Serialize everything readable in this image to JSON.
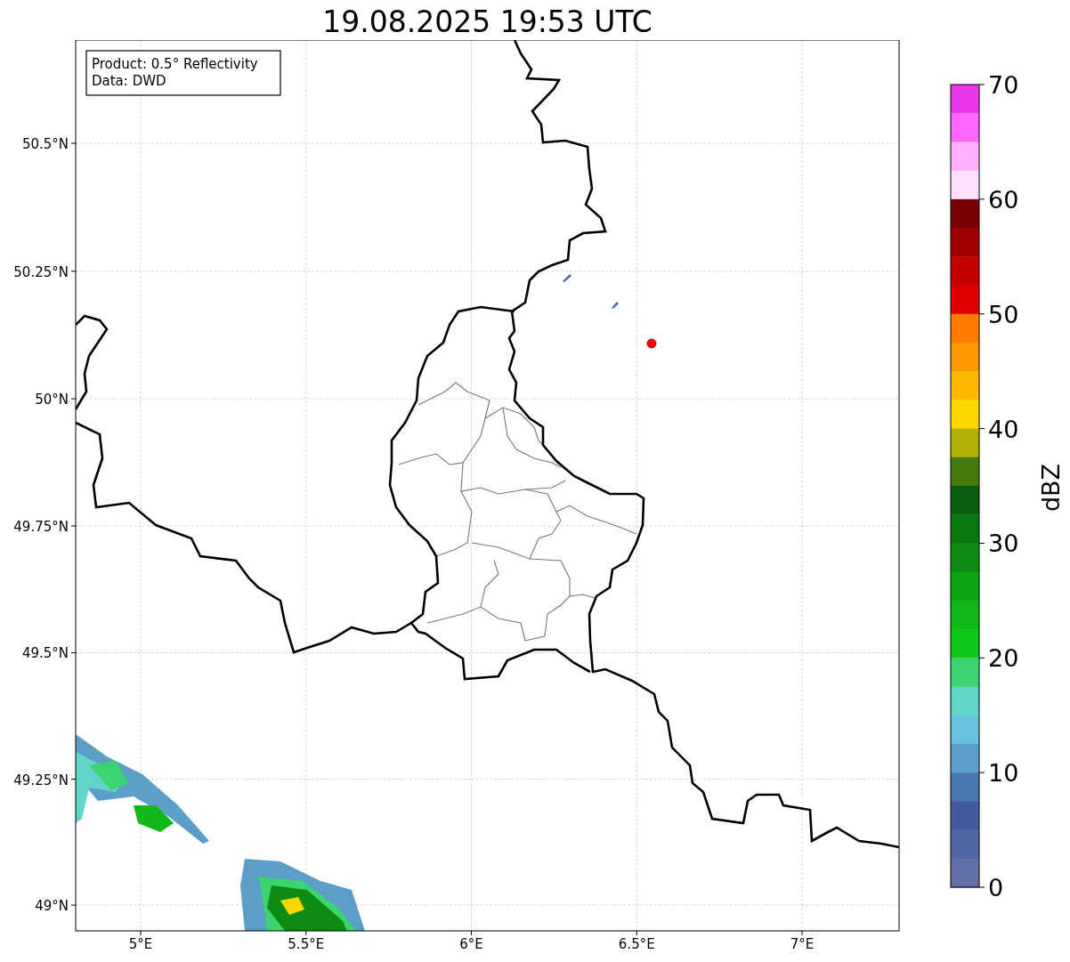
{
  "title": "19.08.2025 19:53 UTC",
  "legend": [
    "Product: 0.5° Reflectivity",
    "Data: DWD"
  ],
  "map": {
    "lat_labels": [
      "50.5°N",
      "50.25°N",
      "50°N",
      "49.75°N",
      "49.5°N",
      "49.25°N",
      "49°N"
    ],
    "lon_labels": [
      "5°E",
      "5.5°E",
      "6°E",
      "6.5°E",
      "7°E"
    ]
  },
  "colorbar": {
    "label": "dBZ",
    "ticks": [
      "70",
      "60",
      "50",
      "40",
      "30",
      "20",
      "10",
      "0"
    ],
    "segments": [
      {
        "color": "#e836e8"
      },
      {
        "color": "#ff66ff"
      },
      {
        "color": "#ffb0ff"
      },
      {
        "color": "#ffe0ff"
      },
      {
        "color": "#780000"
      },
      {
        "color": "#a00000"
      },
      {
        "color": "#c20000"
      },
      {
        "color": "#e00000"
      },
      {
        "color": "#ff7c00"
      },
      {
        "color": "#ff9800"
      },
      {
        "color": "#ffb800"
      },
      {
        "color": "#ffd700"
      },
      {
        "color": "#b0b005"
      },
      {
        "color": "#467a0c"
      },
      {
        "color": "#095f0f"
      },
      {
        "color": "#0b7812"
      },
      {
        "color": "#0d8c13"
      },
      {
        "color": "#0fa515"
      },
      {
        "color": "#10b818"
      },
      {
        "color": "#10c81c"
      },
      {
        "color": "#3cd470"
      },
      {
        "color": "#5fd6c7"
      },
      {
        "color": "#67c2da"
      },
      {
        "color": "#5b9ec7"
      },
      {
        "color": "#4a78b0"
      },
      {
        "color": "#415aa0"
      },
      {
        "color": "#5068a3"
      },
      {
        "color": "#6270a5"
      }
    ]
  }
}
